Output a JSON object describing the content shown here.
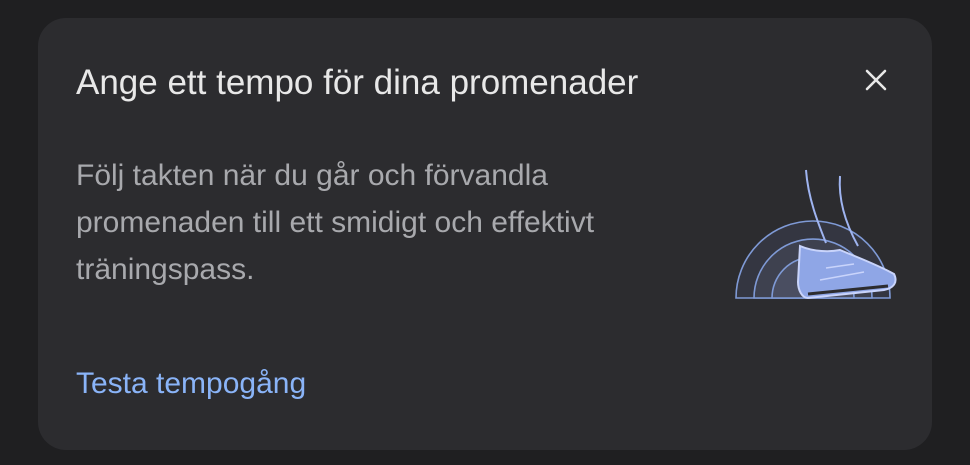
{
  "card": {
    "title": "Ange ett tempo för dina promenader",
    "body": "Följ takten när du går och förvandla promenaden till ett smidigt och effektivt träningspass.",
    "cta_label": "Testa tempogång",
    "close_icon": "close-icon",
    "illustration_icon": "walking-shoe-icon"
  },
  "colors": {
    "background": "#1f1f21",
    "card": "#2c2c2f",
    "title": "#e8e8e8",
    "body": "#a8a9ad",
    "accent": "#8ab4f8"
  }
}
